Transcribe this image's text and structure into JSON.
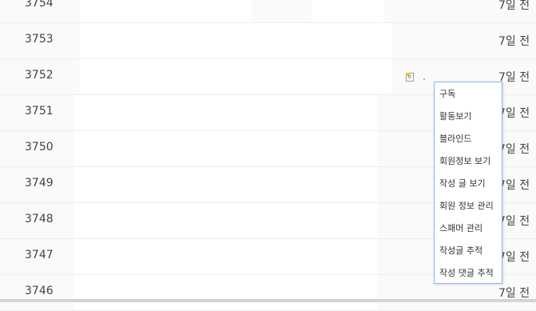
{
  "rows": [
    {
      "number": "3754",
      "date": "7일 전"
    },
    {
      "number": "3753",
      "date": "7일 전"
    },
    {
      "number": "3752",
      "date": "7일 전"
    },
    {
      "number": "3751",
      "date": "7일 전"
    },
    {
      "number": "3750",
      "date": "7일 전"
    },
    {
      "number": "3749",
      "date": "7일 전"
    },
    {
      "number": "3748",
      "date": "7일 전"
    },
    {
      "number": "3747",
      "date": "7일 전"
    },
    {
      "number": "3746",
      "date": "7일 전"
    }
  ],
  "file_icon_digit": "0",
  "context_menu": {
    "items": [
      "구독",
      "활동보기",
      "블라인드",
      "회원정보 보기",
      "작성 글 보기",
      "회원 정보 관리",
      "스패머 관리",
      "작성글 추적",
      "작성 댓글 추적"
    ]
  }
}
